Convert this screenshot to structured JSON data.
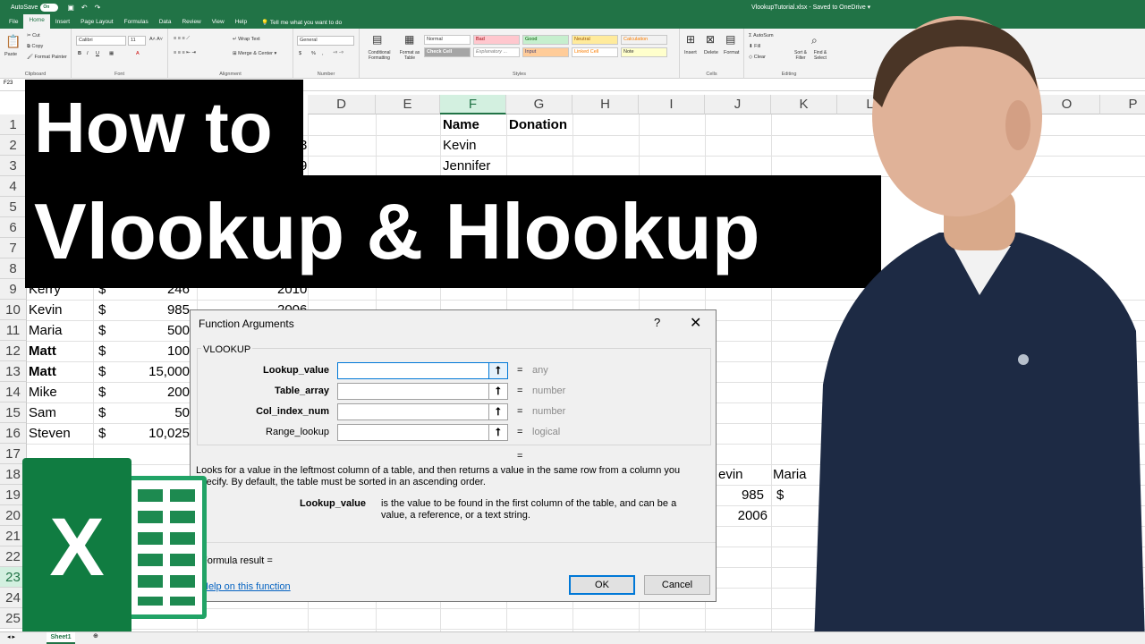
{
  "titlebar": {
    "autosave_label": "AutoSave",
    "autosave_state": "On",
    "document_title": "VlookupTutorial.xlsx  -  Saved to OneDrive  ▾"
  },
  "ribbon_tabs": [
    "File",
    "Home",
    "Insert",
    "Page Layout",
    "Formulas",
    "Data",
    "Review",
    "View",
    "Help"
  ],
  "active_tab": "Home",
  "tell_me": "Tell me what you want to do",
  "ribbon": {
    "clipboard": {
      "paste": "Paste",
      "cut": "Cut",
      "copy": "Copy",
      "format_painter": "Format Painter",
      "label": "Clipboard"
    },
    "font": {
      "family": "Calibri",
      "size": "11",
      "label": "Font"
    },
    "alignment": {
      "wrap": "Wrap Text",
      "merge": "Merge & Center",
      "label": "Alignment"
    },
    "number": {
      "format": "General",
      "currency": "$",
      "percent": "%",
      "comma": ",",
      "label": "Number"
    },
    "styles": {
      "conditional": "Conditional Formatting",
      "format_as_table": "Format as Table",
      "cells": [
        "Normal",
        "Bad",
        "Good",
        "Neutral",
        "Calculation",
        "Check Cell",
        "Explanatory ...",
        "Input",
        "Linked Cell",
        "Note"
      ],
      "label": "Styles"
    },
    "cells": {
      "insert": "Insert",
      "delete": "Delete",
      "format": "Format",
      "label": "Cells"
    },
    "editing": {
      "autosum": "AutoSum",
      "fill": "Fill",
      "clear": "Clear",
      "sort": "Sort & Filter",
      "find": "Find & Select",
      "label": "Editing"
    },
    "colors": {
      "bad_bg": "#ffc7ce",
      "good_bg": "#c6efce",
      "neutral_bg": "#ffeb9c",
      "calc_bg": "#f2f2f2",
      "check_bg": "#a5a5a5",
      "input_bg": "#ffcc99",
      "note_bg": "#ffffcc"
    }
  },
  "name_box": "F23",
  "columns": [
    "D",
    "E",
    "F",
    "G",
    "H",
    "I",
    "J",
    "K",
    "L",
    "O",
    "P"
  ],
  "rows": [
    "1",
    "2",
    "3",
    "4",
    "5",
    "6",
    "7",
    "8",
    "9",
    "10",
    "11",
    "12",
    "13",
    "14",
    "15",
    "16",
    "17",
    "18",
    "19",
    "20",
    "21",
    "22",
    "23",
    "24",
    "25"
  ],
  "cells": {
    "F1": "Name",
    "G1": "Donation",
    "F2": "Kevin",
    "F3": "Jennifer",
    "C2_partial": "3",
    "C3_partial": "9",
    "A9": "Kerry",
    "B9": "$",
    "C9": "246",
    "D9": "2010",
    "A10": "Kevin",
    "B10": "$",
    "C10": "985",
    "D10": "2006",
    "A11": "Maria",
    "B11": "$",
    "C11": "500",
    "A12": "Matt",
    "B12": "$",
    "C12": "100",
    "A13": "Matt",
    "B13": "$",
    "C13": "15,000",
    "A14": "Mike",
    "B14": "$",
    "C14": "200",
    "A15": "Sam",
    "B15": "$",
    "C15": "50",
    "A16": "Steven",
    "B16": "$",
    "C16": "10,025",
    "J18": "evin",
    "K18": "Maria",
    "J19": "985",
    "K19": "$",
    "J20": "2006"
  },
  "overlay": {
    "line1": "How to",
    "line2": "Vlookup & Hlookup"
  },
  "dialog": {
    "title": "Function Arguments",
    "help_glyph": "?",
    "close_glyph": "✕",
    "function_name": "VLOOKUP",
    "args": [
      {
        "label": "Lookup_value",
        "type": "any"
      },
      {
        "label": "Table_array",
        "type": "number"
      },
      {
        "label": "Col_index_num",
        "type": "number"
      },
      {
        "label": "Range_lookup",
        "type": "logical"
      }
    ],
    "equals": "=",
    "description": "Looks for a value in the leftmost column of a table, and then returns a value in the same row from a column you specify. By default, the table must be sorted in an ascending order.",
    "arg_help_label": "Lookup_value",
    "arg_help_text": "is the value to be found in the first column of the table, and can be a value, a reference, or a text string.",
    "formula_result": "Formula result =",
    "help_link": "Help on this function",
    "ok": "OK",
    "cancel": "Cancel",
    "range_button_glyph": "⭡"
  },
  "sheet_tab": "Sheet1",
  "logo_letter": "X"
}
